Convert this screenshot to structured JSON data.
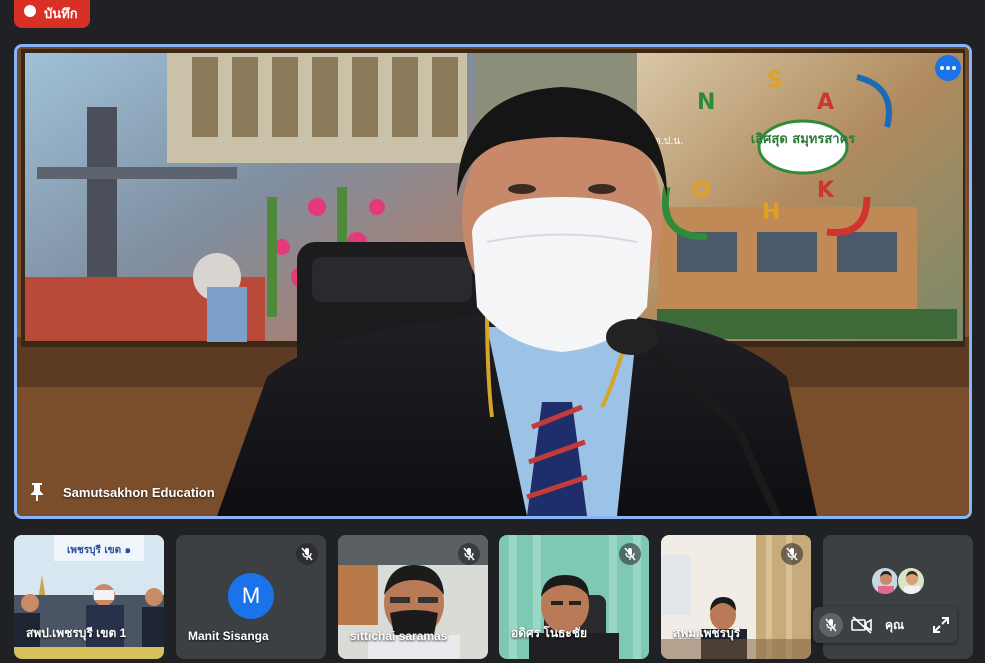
{
  "recording": {
    "label": "บันทึก"
  },
  "main": {
    "presenter_name": "Samutsakhon Education",
    "backdrop_sign": "เลิศสุด สมุทรสาคร",
    "backdrop_small": "ก.ต.ป.น.",
    "more_icon": "more-vert-icon",
    "pin_icon": "pin-icon"
  },
  "thumbnails": [
    {
      "name": "สพป.เพชรบุรี เขต 1",
      "banner": "เพชรบุรี เขต ๑",
      "muted": false
    },
    {
      "name": "Manit Sisanga",
      "avatar_letter": "M",
      "muted": true
    },
    {
      "name": "sittichai saramas",
      "muted": true
    },
    {
      "name": "อดิศร โนธะชัย",
      "muted": true
    },
    {
      "name": "สพม.เพชรบุรี",
      "muted": true
    }
  ],
  "self": {
    "label": "คุณ"
  },
  "colors": {
    "accent": "#1a73e8",
    "record": "#d93025",
    "border_active": "#8ab4f8",
    "background": "#202124",
    "tile": "#3c4043"
  }
}
